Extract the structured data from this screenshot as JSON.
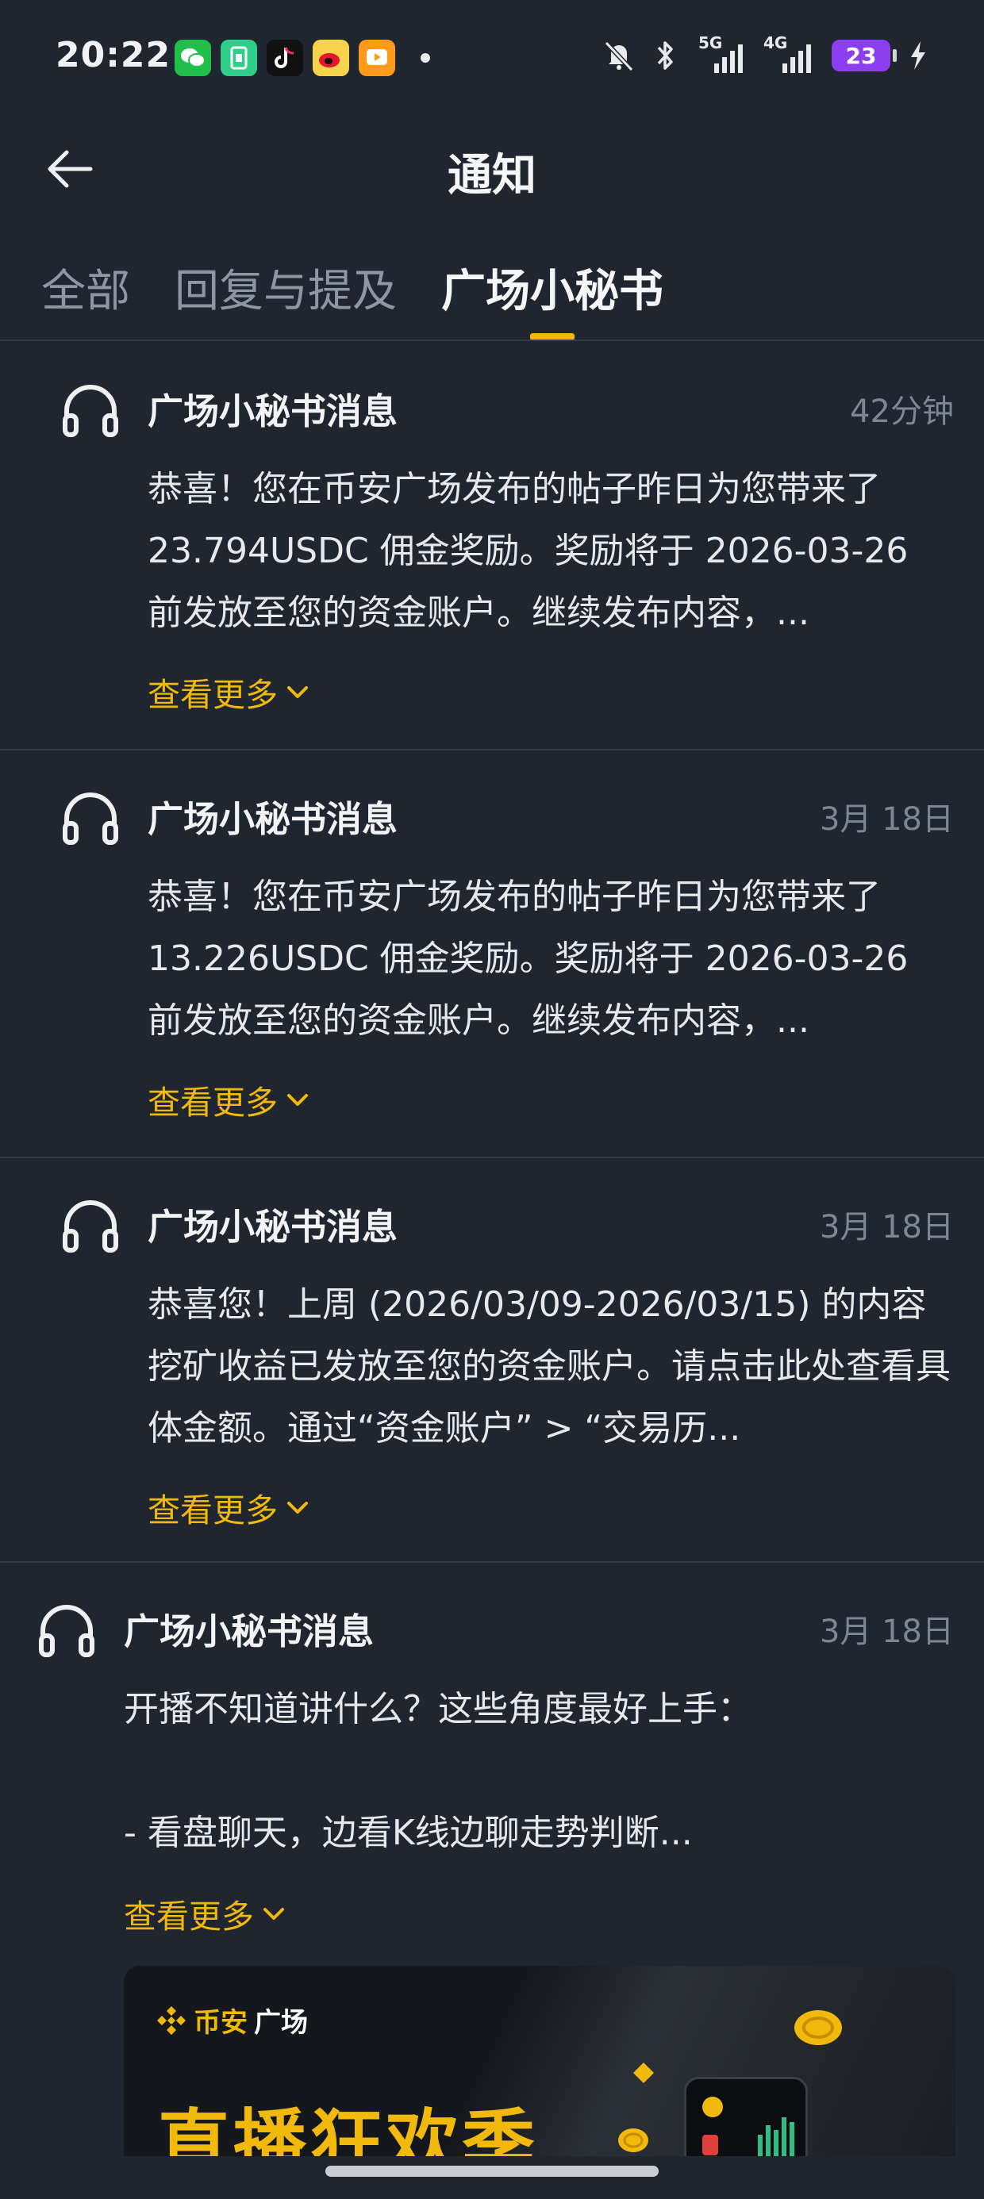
{
  "status_bar": {
    "time": "20:22",
    "battery": "23",
    "network_1": "5G",
    "network_2": "4G",
    "app_icons": [
      "wechat-icon",
      "sim-app-icon",
      "tiktok-icon",
      "weibo-icon",
      "video-app-icon"
    ],
    "status_icons": [
      "mute-bell-icon",
      "bluetooth-icon",
      "signal-icon",
      "charging-icon"
    ]
  },
  "header": {
    "title": "通知"
  },
  "tabs": [
    {
      "label": "全部",
      "active": false
    },
    {
      "label": "回复与提及",
      "active": false
    },
    {
      "label": "广场小秘书",
      "active": true
    }
  ],
  "colors": {
    "background": "#1f2630",
    "accent": "#f0b90b",
    "divider": "#343c47",
    "muted_text": "#7d8693"
  },
  "notifications": [
    {
      "icon": "headset-icon",
      "title": "广场小秘书消息",
      "time": "42分钟",
      "body": "恭喜！您在币安广场发布的帖子昨日为您带来了 23.794USDC 佣金奖励。奖励将于 2026-03-26 前发放至您的资金账户。继续发布内容，...",
      "more": "查看更多"
    },
    {
      "icon": "headset-icon",
      "title": "广场小秘书消息",
      "time": "3月 18日",
      "body": "恭喜！您在币安广场发布的帖子昨日为您带来了 13.226USDC 佣金奖励。奖励将于 2026-03-26 前发放至您的资金账户。继续发布内容，...",
      "more": "查看更多"
    },
    {
      "icon": "headset-icon",
      "title": "广场小秘书消息",
      "time": "3月 18日",
      "body": "恭喜您！上周 (2026/03/09-2026/03/15) 的内容挖矿收益已发放至您的资金账户。请点击此处查看具体金额。通过“资金账户” > “交易历...",
      "more": "查看更多"
    },
    {
      "icon": "headset-icon",
      "title": "广场小秘书消息",
      "time": "3月 18日",
      "body": "开播不知道讲什么？这些角度最好上手：\n\n- 看盘聊天，边看K线边聊走势判断...",
      "more": "查看更多"
    }
  ],
  "banner": {
    "brand_part1": "币安",
    "brand_part2": "广场",
    "headline": "直播狂欢季"
  }
}
